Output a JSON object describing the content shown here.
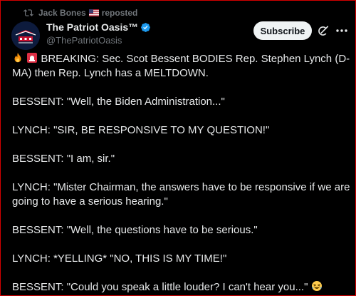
{
  "repost": {
    "user": "Jack Bones",
    "label": "reposted"
  },
  "author": {
    "display_name": "The Patriot Oasis™",
    "handle": "@ThePatriotOasis"
  },
  "actions": {
    "subscribe_label": "Subscribe"
  },
  "tweet": {
    "line1": "BREAKING: Sec. Scot Bessent BODIES Rep. Stephen Lynch (D-",
    "line2": "MA) then Rep. Lynch has a MELTDOWN.",
    "line3": "BESSENT: \"Well, the Biden Administration...\"",
    "line4": "LYNCH: \"SIR, BE RESPONSIVE TO MY QUESTION!\"",
    "line5": "BESSENT: \"I am, sir.\"",
    "line6": "LYNCH: \"Mister Chairman, the answers have to be responsive if we are",
    "line7": "going to have a serious hearing.\"",
    "line8": "BESSENT: \"Well, the questions have to be serious.\"",
    "line9": "LYNCH: *YELLING* \"NO, THIS IS MY TIME!\"",
    "line10": "BESSENT: \"Could you speak a little louder? I can't hear you...\""
  },
  "colors": {
    "background": "#000000",
    "text": "#e7e9ea",
    "muted": "#71767b",
    "verified": "#1d9bf0",
    "subscribe_bg": "#eff3f4",
    "frame_border": "#d40000"
  },
  "icons": [
    "repost-icon",
    "us-flag-icon",
    "verified-badge-icon",
    "grok-icon",
    "more-icon",
    "fire-emoji",
    "siren-emoji",
    "laughing-emoji"
  ]
}
